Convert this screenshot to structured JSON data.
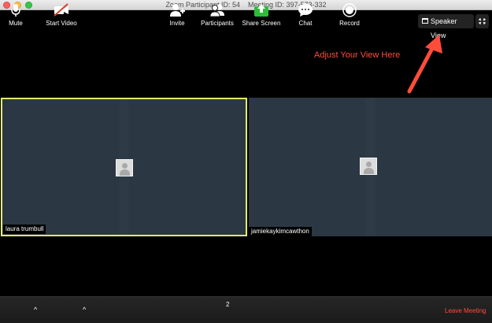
{
  "window": {
    "title": "Zoom Participant ID: 54    Meeting ID: 397-573-332"
  },
  "view_controls": {
    "speaker_view_label": "Speaker View",
    "speaker_view_icon": "speaker-view-icon",
    "fullscreen_icon": "fullscreen-icon"
  },
  "annotation": {
    "text": "Adjust Your View Here",
    "color": "#ff4d3a"
  },
  "participants": [
    {
      "name": "laura trumbull",
      "active_speaker": true,
      "highlight_color": "#e3f06a"
    },
    {
      "name": "jamiekaykimcawthon",
      "active_speaker": false
    }
  ],
  "toolbar": {
    "mute_label": "Mute",
    "start_video_label": "Start Video",
    "invite_label": "Invite",
    "participants_label": "Participants",
    "participants_count": "2",
    "share_screen_label": "Share Screen",
    "chat_label": "Chat",
    "record_label": "Record",
    "leave_label": "Leave Meeting",
    "share_color": "#2dbd3b",
    "leave_color": "#ff4d3a"
  }
}
